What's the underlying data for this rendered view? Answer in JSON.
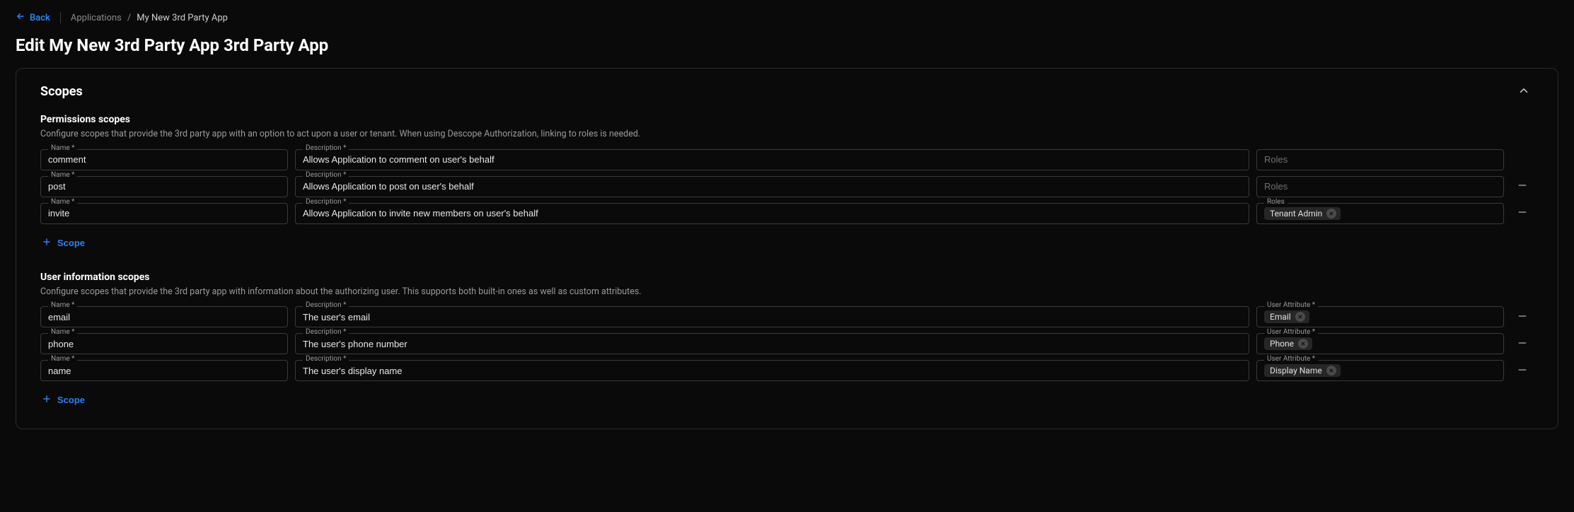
{
  "nav": {
    "back_label": "Back",
    "crumb_root": "Applications",
    "crumb_sep": "/",
    "crumb_current": "My New 3rd Party App"
  },
  "page_title": "Edit My New 3rd Party App 3rd Party App",
  "card": {
    "title": "Scopes",
    "sections": {
      "permissions": {
        "heading": "Permissions scopes",
        "description": "Configure scopes that provide the 3rd party app with an option to act upon a user or tenant. When using Descope Authorization, linking to roles is needed.",
        "labels": {
          "name": "Name *",
          "desc": "Description *",
          "roles": "Roles",
          "roles_placeholder": "Roles"
        },
        "rows": [
          {
            "name": "comment",
            "desc": "Allows Application to comment on user's behalf",
            "roles": [],
            "deletable": false
          },
          {
            "name": "post",
            "desc": "Allows Application to post on user's behalf",
            "roles": [],
            "deletable": true
          },
          {
            "name": "invite",
            "desc": "Allows Application to invite new members on user's behalf",
            "roles": [
              "Tenant Admin"
            ],
            "deletable": true
          }
        ],
        "add_label": "Scope"
      },
      "userinfo": {
        "heading": "User information scopes",
        "description": "Configure scopes that provide the 3rd party app with information about the authorizing user. This supports both built-in ones as well as custom attributes.",
        "labels": {
          "name": "Name *",
          "desc": "Description *",
          "attr": "User Attribute *"
        },
        "rows": [
          {
            "name": "email",
            "desc": "The user's email",
            "attr": "Email"
          },
          {
            "name": "phone",
            "desc": "The user's phone number",
            "attr": "Phone"
          },
          {
            "name": "name",
            "desc": "The user's display name",
            "attr": "Display Name"
          }
        ],
        "add_label": "Scope"
      }
    }
  }
}
